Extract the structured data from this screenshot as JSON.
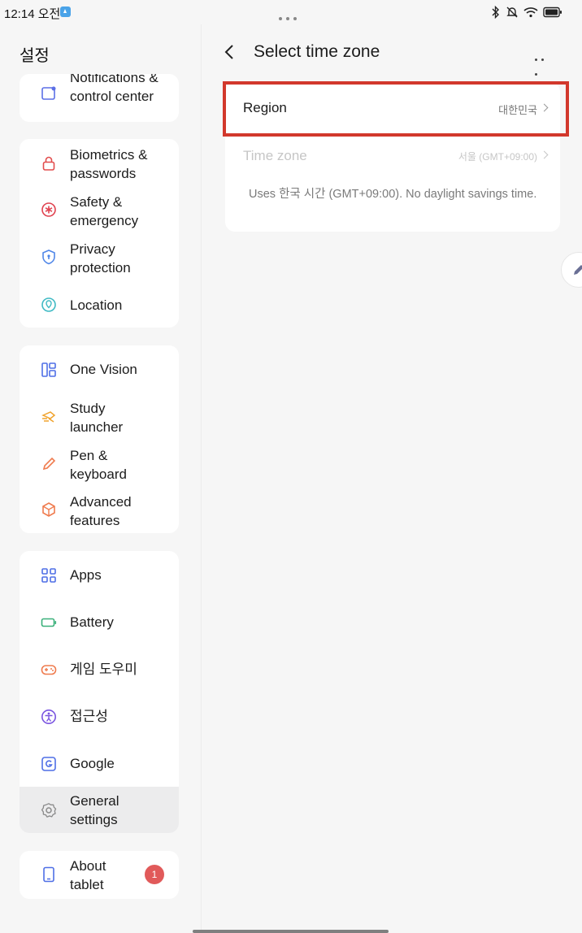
{
  "status_bar": {
    "time": "12:14 오전",
    "colors": {
      "app_icon": "#4aa3e8"
    }
  },
  "sidebar": {
    "title": "설정",
    "groups": [
      {
        "items": [
          {
            "label": "Notifications & control center",
            "icon": "notification-icon"
          }
        ]
      },
      {
        "items": [
          {
            "label": "Biometrics & passwords",
            "icon": "lock-icon"
          },
          {
            "label": "Safety & emergency",
            "icon": "emergency-icon"
          },
          {
            "label": "Privacy protection",
            "icon": "shield-icon"
          },
          {
            "label": "Location",
            "icon": "location-pin-icon"
          }
        ]
      },
      {
        "items": [
          {
            "label": "One Vision",
            "icon": "one-vision-icon"
          },
          {
            "label": "Study launcher",
            "icon": "study-launcher-icon"
          },
          {
            "label": "Pen & keyboard",
            "icon": "pen-icon"
          },
          {
            "label": "Advanced features",
            "icon": "cube-icon"
          }
        ]
      },
      {
        "items": [
          {
            "label": "Apps",
            "icon": "apps-grid-icon"
          },
          {
            "label": "Battery",
            "icon": "battery-icon"
          },
          {
            "label": "게임 도우미",
            "icon": "gamepad-icon"
          },
          {
            "label": "접근성",
            "icon": "accessibility-icon"
          },
          {
            "label": "Google",
            "icon": "google-icon"
          },
          {
            "label": "General settings",
            "icon": "gear-icon",
            "selected": true
          }
        ]
      },
      {
        "items": [
          {
            "label": "About tablet",
            "icon": "tablet-icon",
            "badge": "1"
          }
        ]
      }
    ]
  },
  "main": {
    "title": "Select time zone",
    "region": {
      "label": "Region",
      "value": "대한민국"
    },
    "time_zone": {
      "label": "Time zone",
      "value": "서울 (GMT+09:00)",
      "enabled": false
    },
    "note": "Uses 한국 시간 (GMT+09:00). No daylight savings time."
  },
  "colors": {
    "highlight_border": "#d2382c",
    "badge": "#e15a5a",
    "selected_row": "#ececed"
  }
}
